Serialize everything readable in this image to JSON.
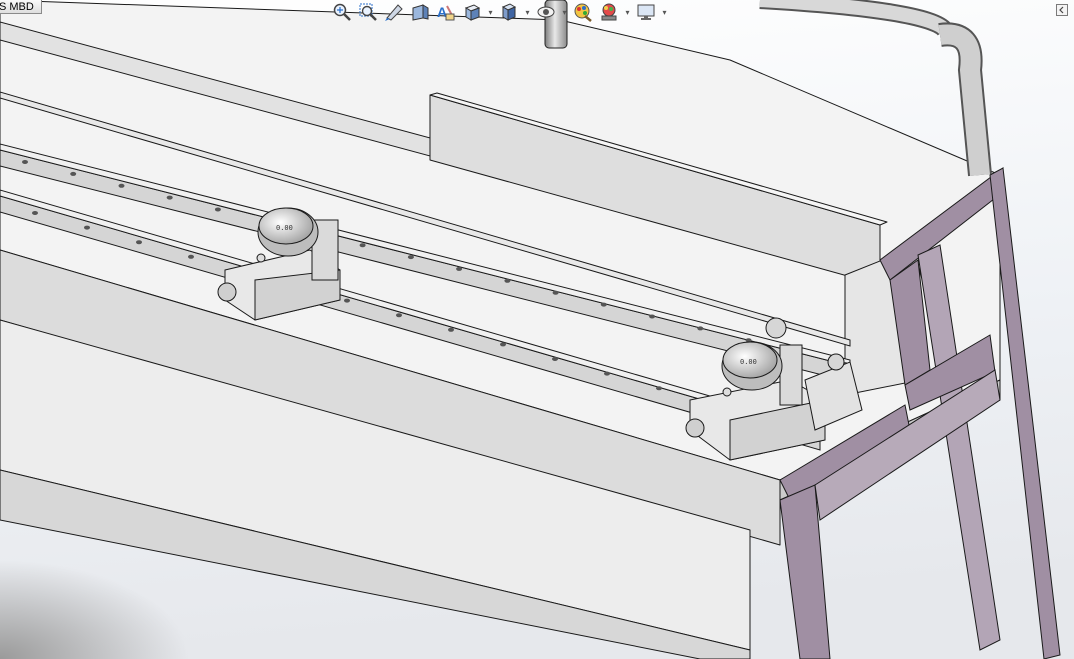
{
  "window": {
    "tab_label": "S MBD"
  },
  "heads_up_toolbar": {
    "tools": [
      {
        "name": "zoom-to-fit",
        "icon": "zoom-fit-icon"
      },
      {
        "name": "zoom-to-area",
        "icon": "zoom-area-icon"
      },
      {
        "name": "previous-view",
        "icon": "previous-view-icon"
      },
      {
        "name": "section-view",
        "icon": "section-view-icon"
      },
      {
        "name": "dynamic-annotation",
        "icon": "annotation-icon"
      },
      {
        "name": "view-orientation",
        "icon": "view-orientation-icon",
        "dropdown": true
      },
      {
        "name": "display-style",
        "icon": "display-style-icon",
        "dropdown": true
      },
      {
        "name": "hide-show-items",
        "icon": "hide-show-icon",
        "dropdown": true
      },
      {
        "name": "edit-appearance",
        "icon": "appearance-icon"
      },
      {
        "name": "apply-scene",
        "icon": "scene-icon",
        "dropdown": true
      },
      {
        "name": "view-settings",
        "icon": "monitor-icon",
        "dropdown": true
      }
    ]
  },
  "model": {
    "colors": {
      "background_top": "#ffffff",
      "background_mid": "#eef1f5",
      "bench_light": "#f2f2f2",
      "bench_face": "#e4e4e4",
      "bench_side": "#cfcfcf",
      "frame_purple": "#a08fa3",
      "rail": "#d9d9d9",
      "edge": "#1a1a1a"
    }
  }
}
